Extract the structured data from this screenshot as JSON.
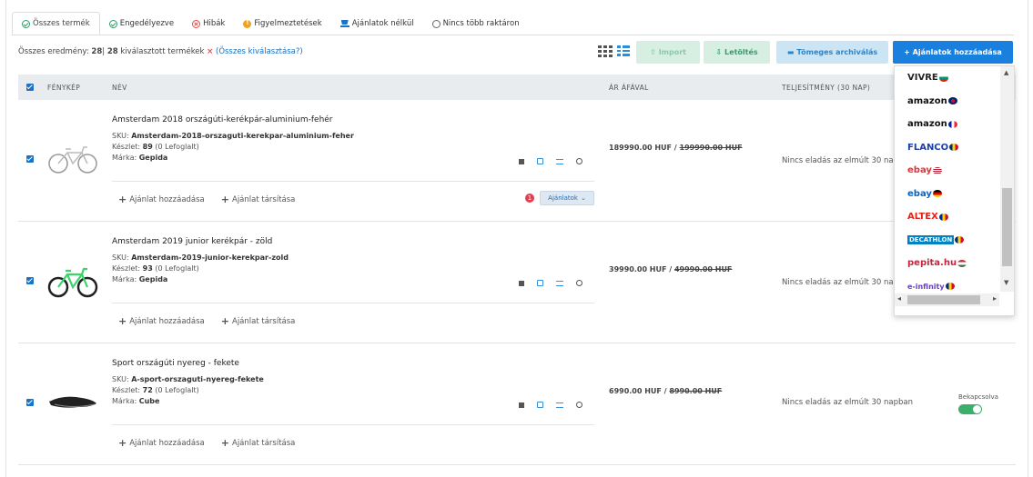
{
  "tabs": [
    {
      "label": "Összes termék",
      "icon": "check-circle-icon"
    },
    {
      "label": "Engedélyezve",
      "icon": "check-circle-icon"
    },
    {
      "label": "Hibák",
      "icon": "error-circle-icon"
    },
    {
      "label": "Figyelmeztetések",
      "icon": "warning-icon"
    },
    {
      "label": "Ajánlatok nélkül",
      "icon": "cart-icon"
    },
    {
      "label": "Nincs több raktáron",
      "icon": "empty-circle-icon"
    }
  ],
  "summary": {
    "prefix": "Összes eredmény:",
    "total": "28",
    "sep": "|",
    "selected": "28",
    "selected_text": "kiválasztott termékek",
    "clear": "×",
    "select_all": "(Összes kiválasztása?)"
  },
  "toolbar": {
    "import": "Import",
    "download": "Letöltés",
    "archive": "Tömeges archiválás",
    "add_offers": "+ Ajánlatok hozzáadása"
  },
  "table": {
    "headers": [
      "FÉNYKÉP",
      "NÉV",
      "ÁR ÁFÁVAL",
      "TELJESÍTMÉNY (30 NAP)"
    ]
  },
  "products": [
    {
      "name": "Amsterdam 2018 országúti-kerékpár-aluminium-fehér",
      "sku_label": "SKU:",
      "sku": "Amsterdam-2018-orszaguti-kerekpar-aluminium-feher",
      "stock_label": "Készlet:",
      "stock": "89",
      "reserved": "(0 Lefoglalt)",
      "brand_label": "Márka:",
      "brand": "Gepida",
      "price": "189990.00 HUF /",
      "old_price": "199990.00 HUF",
      "performance": "Nincs eladás az elmúlt 30 na",
      "add_offer": "Ajánlat hozzáadása",
      "link_offer": "Ajánlat társítása",
      "badge": "1",
      "offers_btn": "Ajánlatok"
    },
    {
      "name": "Amsterdam 2019 junior kerékpár - zöld",
      "sku_label": "SKU:",
      "sku": "Amsterdam-2019-junior-kerekpar-zold",
      "stock_label": "Készlet:",
      "stock": "93",
      "reserved": "(0 Lefoglalt)",
      "brand_label": "Márka:",
      "brand": "Gepida",
      "price": "39990.00 HUF /",
      "old_price": "49990.00 HUF",
      "performance": "Nincs eladás az elmúlt 30 na",
      "add_offer": "Ajánlat hozzáadása",
      "link_offer": "Ajánlat társítása"
    },
    {
      "name": "Sport országúti nyereg - fekete",
      "sku_label": "SKU:",
      "sku": "A-sport-orszaguti-nyereg-fekete",
      "stock_label": "Készlet:",
      "stock": "72",
      "reserved": "(0 Lefoglalt)",
      "brand_label": "Márka:",
      "brand": "Cube",
      "price": "6990.00 HUF /",
      "old_price": "8990.00 HUF",
      "performance": "Nincs eladás az elmúlt 30 napban",
      "toggle_label": "Bekapcsolva",
      "add_offer": "Ajánlat hozzáadása",
      "link_offer": "Ajánlat társítása"
    }
  ],
  "marketplaces": [
    {
      "name": "VIVRE",
      "color": "#222",
      "flag": "bg"
    },
    {
      "name": "amazon",
      "color": "#111",
      "flag": "uk"
    },
    {
      "name": "amazon",
      "color": "#111",
      "flag": "fr"
    },
    {
      "name": "FLANCO",
      "color": "#1a3fa8",
      "flag": "ro"
    },
    {
      "name": "ebay",
      "color": "#e53238",
      "flag": "us"
    },
    {
      "name": "ebay",
      "color": "#0064d2",
      "flag": "de"
    },
    {
      "name": "ALTEX",
      "color": "#e2231a",
      "flag": "ro"
    },
    {
      "name": "DECATHLON",
      "color": "#0082c3",
      "flag": "ro"
    },
    {
      "name": "pepita.hu",
      "color": "#d21f3c",
      "flag": "hu"
    },
    {
      "name": "e-infinity",
      "color": "#6a3fc0",
      "flag": "ro"
    }
  ],
  "colors": {
    "primary": "#1a80e0",
    "success": "#3daf6c",
    "danger": "#e44c4c"
  }
}
